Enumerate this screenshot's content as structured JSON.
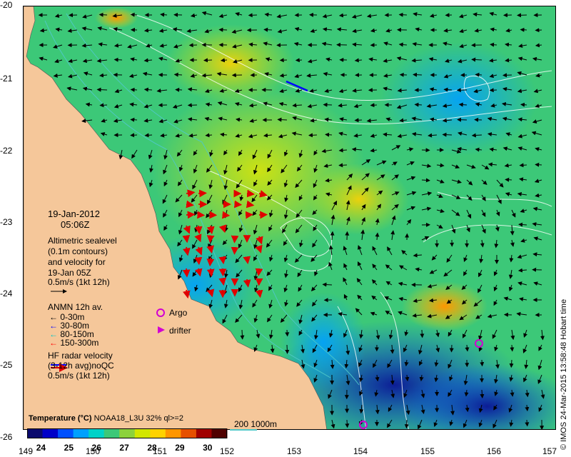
{
  "map": {
    "lat_ticks": [
      "-20",
      "-21",
      "-22",
      "-23",
      "-24",
      "-25",
      "-26"
    ],
    "lon_ticks": [
      "149",
      "150",
      "151",
      "152",
      "153",
      "154",
      "155",
      "156",
      "157"
    ],
    "lon_range": [
      149,
      157
    ],
    "lat_range": [
      -26,
      -20
    ]
  },
  "annotation": {
    "date": "19-Jan-2012",
    "time": "05:06Z",
    "altimetry_lines": [
      "Altimetric sealevel",
      "(0.1m contours)",
      "and velocity for",
      "19-Jan 05Z",
      "0.5m/s (1kt 12h)"
    ],
    "anmn_title": "ANMN 12h av.",
    "anmn_items": [
      {
        "label": "0-30m",
        "color": "#000000"
      },
      {
        "label": "30-80m",
        "color": "#0000ff"
      },
      {
        "label": "80-150m",
        "color": "#00c8c8"
      },
      {
        "label": "150-300m",
        "color": "#ff0000"
      }
    ],
    "argo_label": "Argo",
    "drifter_label": "drifter",
    "hf_lines": [
      "HF radar velocity",
      "(3-12h avg)noQC",
      "0.5m/s (1kt 12h)"
    ]
  },
  "colorbar": {
    "title_bold": "Temperature (°C)",
    "title_rest": " NOAA18_L3U 32% ql>=2",
    "ticks": [
      "24",
      "25",
      "26",
      "27",
      "28",
      "29",
      "30"
    ],
    "range": [
      23.5,
      30.7
    ],
    "isobath_label": "200  1000m",
    "colors": [
      "#0a0a6e",
      "#0000c8",
      "#0050ff",
      "#00a0ff",
      "#00d2c8",
      "#3cc878",
      "#8cd23c",
      "#d2e600",
      "#ffd200",
      "#ff9600",
      "#e65000",
      "#a00000",
      "#500000"
    ]
  },
  "credit": "© IMOS 24-Mar-2015 13:58:48 Hobart time",
  "colors": {
    "land": "#f5c79a",
    "argo": "#d200d2",
    "isobath": "#50c8c8"
  }
}
